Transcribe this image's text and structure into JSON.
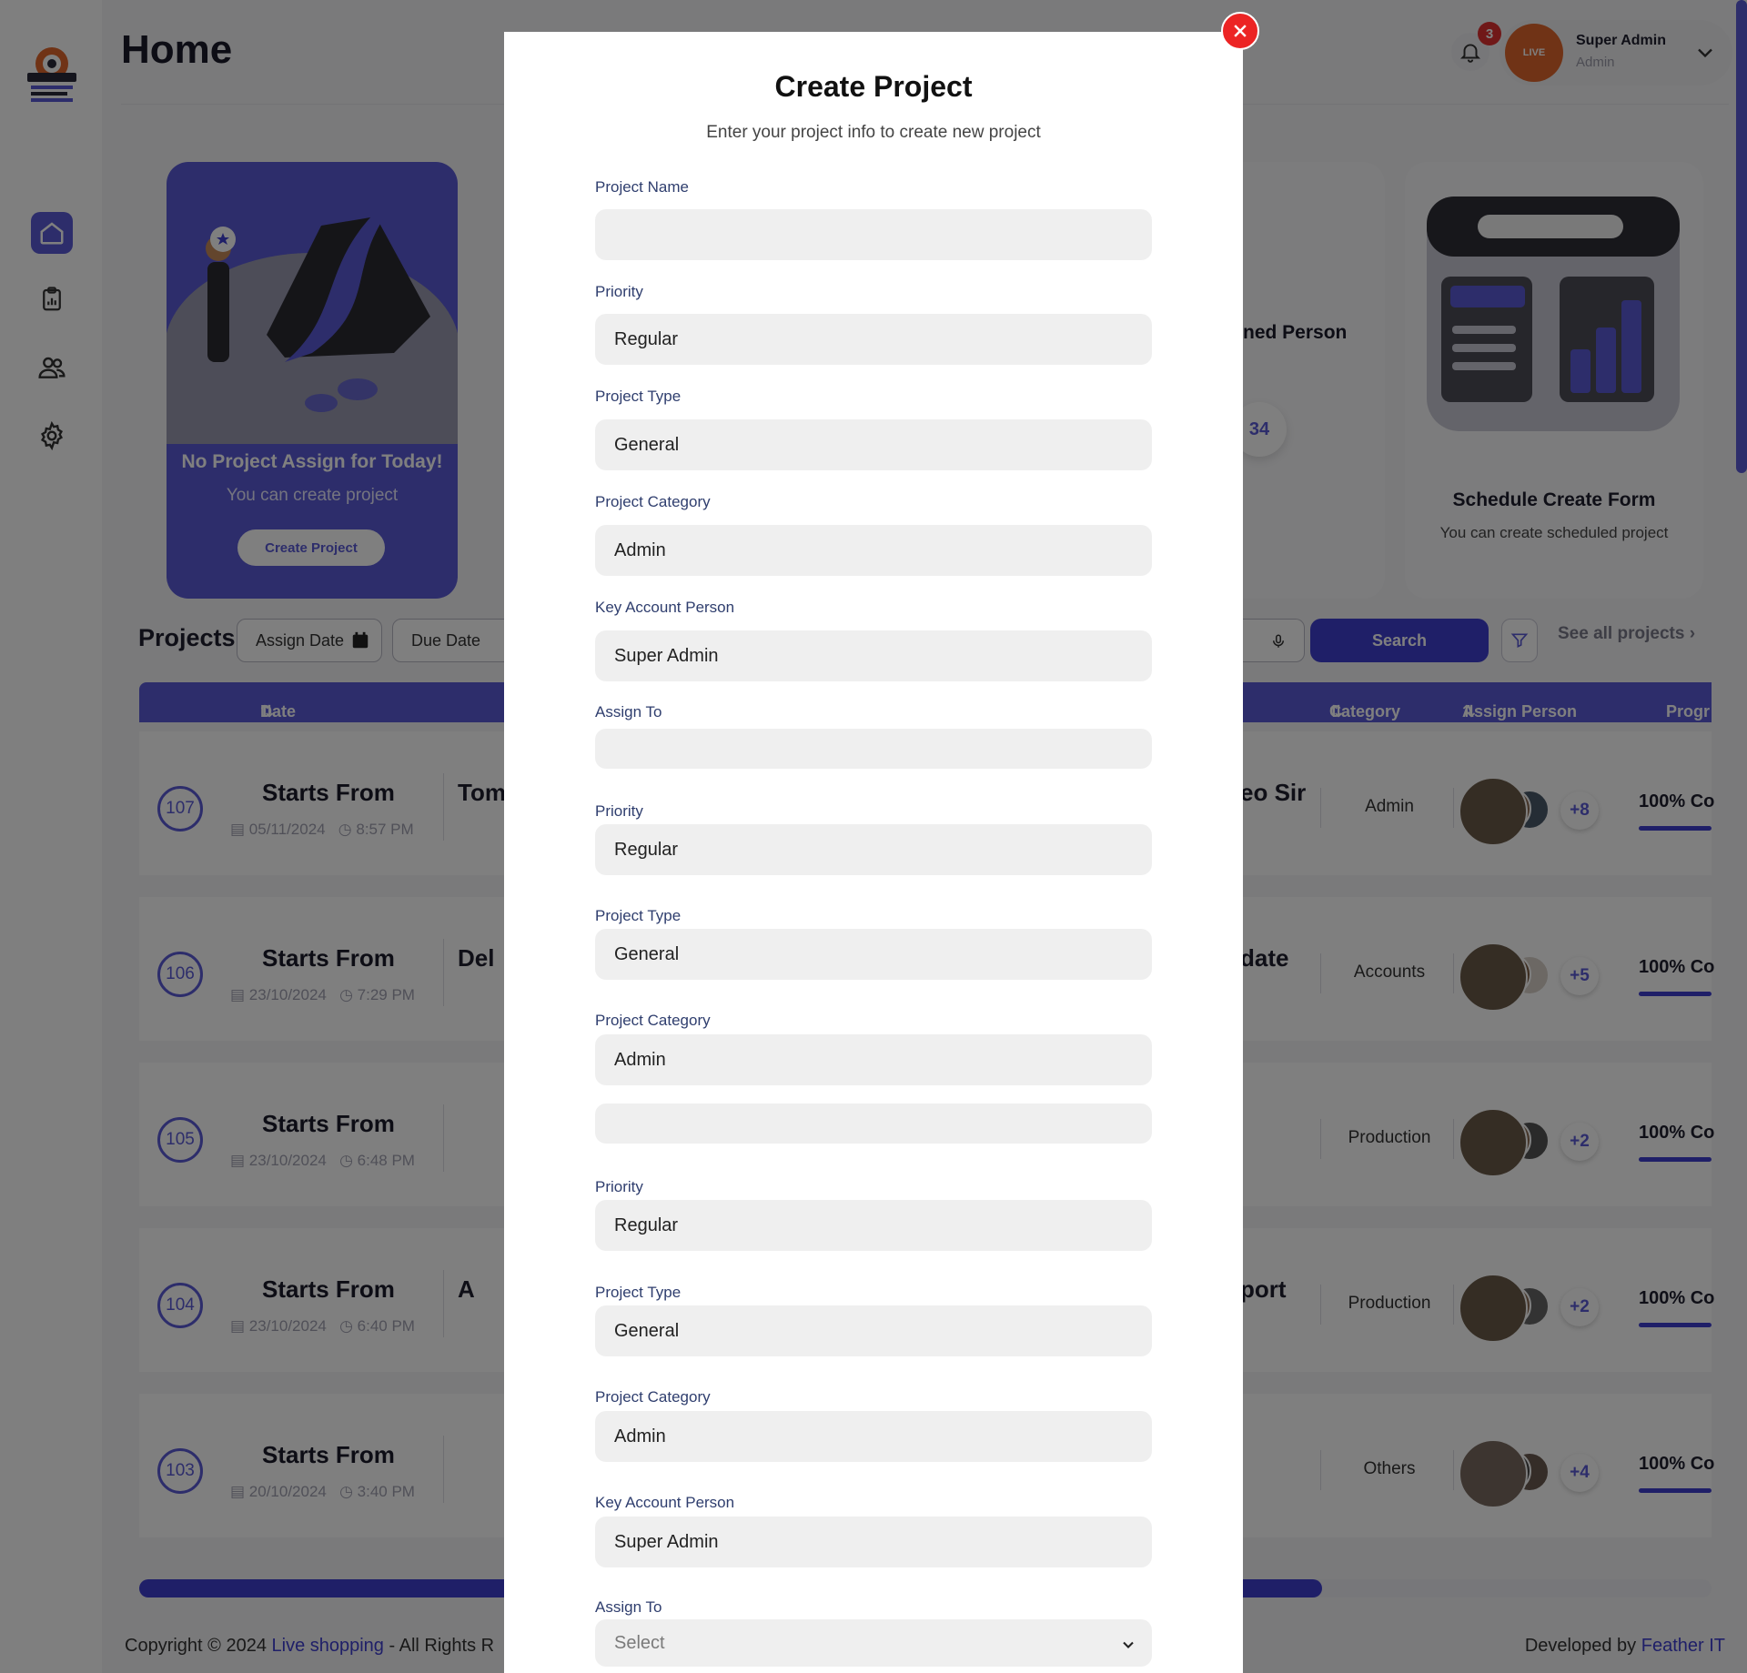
{
  "header": {
    "title": "Home"
  },
  "notifications": {
    "count": "3"
  },
  "user": {
    "name": "Super Admin",
    "role": "Admin",
    "avatar_text": "LIVE"
  },
  "cards": {
    "no_project": {
      "title": "No Project Assign for Today!",
      "subtitle": "You can create project",
      "button": "Create Project"
    },
    "assigned": {
      "title": "ned Person",
      "count": "34"
    },
    "schedule": {
      "title": "Schedule Create Form",
      "subtitle": "You can create scheduled project"
    }
  },
  "projects": {
    "label": "Projects",
    "filters": {
      "assign_date": "Assign Date",
      "due_date": "Due Date"
    },
    "search_button": "Search",
    "see_all": "See all projects",
    "columns": {
      "date": "Date",
      "category": "Category",
      "assign_person": "Assign Person",
      "progress": "Progr"
    },
    "rows": [
      {
        "id": "107",
        "starts": "Starts From",
        "date": "05/11/2024",
        "time": "8:57 PM",
        "title": "Tom",
        "title_right": "eo Sir",
        "category": "Admin",
        "more": "+8",
        "progress": "100% Co"
      },
      {
        "id": "106",
        "starts": "Starts From",
        "date": "23/10/2024",
        "time": "7:29 PM",
        "title": "Del",
        "title_right": "date",
        "category": "Accounts",
        "more": "+5",
        "progress": "100% Co"
      },
      {
        "id": "105",
        "starts": "Starts From",
        "date": "23/10/2024",
        "time": "6:48 PM",
        "title": "",
        "title_right": "",
        "category": "Production",
        "more": "+2",
        "progress": "100% Co"
      },
      {
        "id": "104",
        "starts": "Starts From",
        "date": "23/10/2024",
        "time": "6:40 PM",
        "title": "A",
        "title_right": "port",
        "category": "Production",
        "more": "+2",
        "progress": "100% Co"
      },
      {
        "id": "103",
        "starts": "Starts From",
        "date": "20/10/2024",
        "time": "3:40 PM",
        "title": "",
        "title_right": "",
        "category": "Others",
        "more": "+4",
        "progress": "100% Co"
      }
    ]
  },
  "footer": {
    "copyright": "Copyright © 2024 ",
    "brand": "Live shopping",
    "rights": " - All Rights R",
    "developed": "Developed by ",
    "developer": "Feather IT"
  },
  "modal": {
    "title": "Create Project",
    "subtitle": "Enter your project info to create new project",
    "fields": [
      {
        "label": "Project Name",
        "value": ""
      },
      {
        "label": "Priority",
        "value": "Regular"
      },
      {
        "label": "Project Type",
        "value": "General"
      },
      {
        "label": "Project Category",
        "value": "Admin"
      },
      {
        "label": "Key Account Person",
        "value": "Super Admin"
      },
      {
        "label": "Assign To",
        "value": ""
      },
      {
        "label": "Priority",
        "value": "Regular"
      },
      {
        "label": "Project Type",
        "value": "General"
      },
      {
        "label": "Project Category",
        "value": "Admin"
      },
      {
        "label": "",
        "value": ""
      },
      {
        "label": "Priority",
        "value": "Regular"
      },
      {
        "label": "Project Type",
        "value": "General"
      },
      {
        "label": "Project Category",
        "value": "Admin"
      },
      {
        "label": "Key Account Person",
        "value": "Super Admin"
      },
      {
        "label": "Assign To",
        "value": "Select"
      }
    ]
  },
  "colors": {
    "accent": "#5b5bd6",
    "button": "#3f3fd1",
    "close": "#ec2424",
    "logo": "#e0672c"
  }
}
